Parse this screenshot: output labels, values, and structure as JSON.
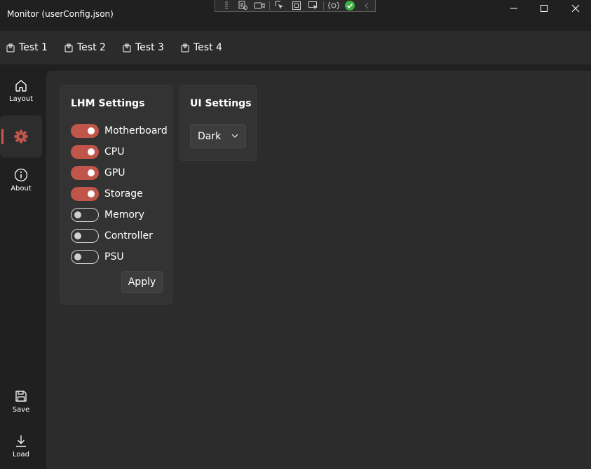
{
  "window": {
    "title": "Monitor (userConfig.json)"
  },
  "tabs": [
    {
      "label": "Test 1"
    },
    {
      "label": "Test 2"
    },
    {
      "label": "Test 3"
    },
    {
      "label": "Test 4"
    }
  ],
  "nav": {
    "top": [
      {
        "label": "Layout",
        "icon": "home-icon"
      },
      {
        "label": "",
        "icon": "gear-icon",
        "selected": true
      },
      {
        "label": "About",
        "icon": "info-icon"
      }
    ],
    "bottom": [
      {
        "label": "Save",
        "icon": "save-icon"
      },
      {
        "label": "Load",
        "icon": "download-icon"
      }
    ]
  },
  "lhm_settings": {
    "title": "LHM Settings",
    "toggles": [
      {
        "label": "Motherboard",
        "on": true
      },
      {
        "label": "CPU",
        "on": true
      },
      {
        "label": "GPU",
        "on": true
      },
      {
        "label": "Storage",
        "on": true
      },
      {
        "label": "Memory",
        "on": false
      },
      {
        "label": "Controller",
        "on": false
      },
      {
        "label": "PSU",
        "on": false
      }
    ],
    "apply_label": "Apply"
  },
  "ui_settings": {
    "title": "UI Settings",
    "theme_selected": "Dark"
  },
  "colors": {
    "accent": "#c0564a",
    "background": "#202020",
    "content": "#2c2c2c",
    "card": "#333333"
  }
}
